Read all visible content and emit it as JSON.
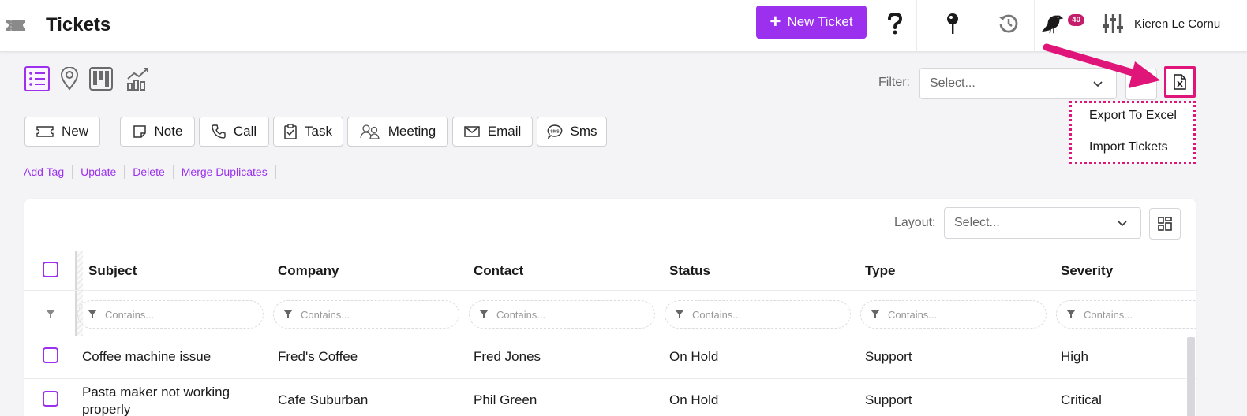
{
  "header": {
    "title": "Tickets",
    "new_ticket_label": "New Ticket",
    "notification_count": "40",
    "user_name": "Kieren Le Cornu"
  },
  "toolbar": {
    "filter_label": "Filter:",
    "filter_placeholder": "Select...",
    "dropdown": {
      "export_label": "Export To Excel",
      "import_label": "Import Tickets"
    }
  },
  "actions": [
    {
      "label": "New",
      "icon": "ticket-icon"
    },
    {
      "label": "Note",
      "icon": "note-icon"
    },
    {
      "label": "Call",
      "icon": "phone-icon"
    },
    {
      "label": "Task",
      "icon": "clipboard-check-icon"
    },
    {
      "label": "Meeting",
      "icon": "meeting-icon"
    },
    {
      "label": "Email",
      "icon": "envelope-icon"
    },
    {
      "label": "Sms",
      "icon": "sms-bubble-icon"
    }
  ],
  "links": [
    "Add Tag",
    "Update",
    "Delete",
    "Merge Duplicates"
  ],
  "table": {
    "layout_label": "Layout:",
    "layout_placeholder": "Select...",
    "filter_placeholder": "Contains...",
    "columns": [
      "Subject",
      "Company",
      "Contact",
      "Status",
      "Type",
      "Severity"
    ],
    "rows": [
      [
        "Coffee machine issue",
        "Fred's Coffee",
        "Fred Jones",
        "On Hold",
        "Support",
        "High"
      ],
      [
        "Pasta maker not working properly",
        "Cafe Suburban",
        "Phil Green",
        "On Hold",
        "Support",
        "Critical"
      ]
    ]
  },
  "colors": {
    "accent": "#9b30ef",
    "highlight": "#e0157a",
    "badge": "#c41e6b"
  }
}
